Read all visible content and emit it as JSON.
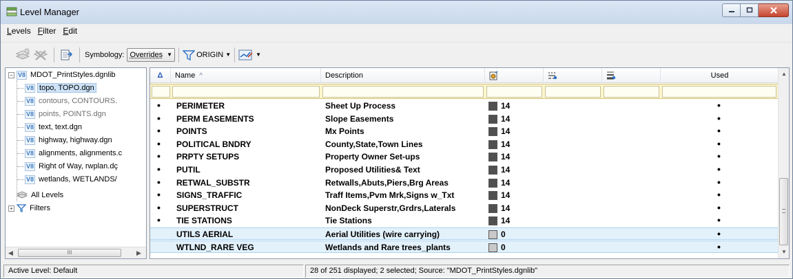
{
  "window": {
    "title": "Level Manager",
    "accent_color": "#cfdbea"
  },
  "menu": {
    "items": [
      {
        "underline": "L",
        "rest": "evels"
      },
      {
        "underline": "F",
        "rest": "ilter"
      },
      {
        "underline": "E",
        "rest": "dit"
      }
    ]
  },
  "toolbar": {
    "symbology_label": "Symbology:",
    "symbology_value": "Overrides",
    "origin_label": "ORIGIN"
  },
  "tree": {
    "root": "MDOT_PrintStyles.dgnlib",
    "children": [
      "topo, TOPO.dgn",
      "contours, CONTOURS.",
      "points, POINTS.dgn",
      "text, text.dgn",
      "highway, highway.dgn",
      "alignments, alignments.c",
      "Right of Way, rwplan.dç",
      "wetlands, WETLANDS/"
    ],
    "all_levels": "All Levels",
    "filters": "Filters",
    "scroll_grip": "III"
  },
  "table": {
    "headers": {
      "sort_indicator": "Δ",
      "name": "Name",
      "name_sort": "^",
      "description": "Description",
      "used": "Used"
    },
    "rows": [
      {
        "mark": "•",
        "name": "PERIMETER",
        "description": "Sheet Up Process",
        "color": "#505050",
        "weight": "14",
        "used": "•",
        "selected": false
      },
      {
        "mark": "•",
        "name": "PERM EASEMENTS",
        "description": "Slope Easements",
        "color": "#505050",
        "weight": "14",
        "used": "•",
        "selected": false
      },
      {
        "mark": "•",
        "name": "POINTS",
        "description": "Mx Points",
        "color": "#505050",
        "weight": "14",
        "used": "•",
        "selected": false
      },
      {
        "mark": "•",
        "name": "POLITICAL BNDRY",
        "description": "County,State,Town Lines",
        "color": "#505050",
        "weight": "14",
        "used": "•",
        "selected": false
      },
      {
        "mark": "•",
        "name": "PRPTY SETUPS",
        "description": "Property Owner Set-ups",
        "color": "#505050",
        "weight": "14",
        "used": "•",
        "selected": false
      },
      {
        "mark": "•",
        "name": "PUTIL",
        "description": "Proposed Utilities& Text",
        "color": "#505050",
        "weight": "14",
        "used": "•",
        "selected": false
      },
      {
        "mark": "•",
        "name": "RETWAL_SUBSTR",
        "description": "Retwalls,Abuts,Piers,Brg Areas",
        "color": "#505050",
        "weight": "14",
        "used": "•",
        "selected": false
      },
      {
        "mark": "•",
        "name": "SIGNS_TRAFFIC",
        "description": "Traff Items,Pvm Mrk,Signs w_Txt",
        "color": "#505050",
        "weight": "14",
        "used": "•",
        "selected": false
      },
      {
        "mark": "•",
        "name": "SUPERSTRUCT",
        "description": "NonDeck Superstr,Grdrs,Laterals",
        "color": "#505050",
        "weight": "14",
        "used": "•",
        "selected": false
      },
      {
        "mark": "•",
        "name": "TIE STATIONS",
        "description": "Tie Stations",
        "color": "#505050",
        "weight": "14",
        "used": "•",
        "selected": false
      },
      {
        "mark": "",
        "name": "UTILS AERIAL",
        "description": "Aerial Utilities (wire carrying)",
        "color": "#c8c8c8",
        "weight": "0",
        "used": "•",
        "selected": true
      },
      {
        "mark": "",
        "name": "WTLND_RARE VEG",
        "description": "Wetlands and Rare trees_plants",
        "color": "#c8c8c8",
        "weight": "0",
        "used": "•",
        "selected": true
      }
    ]
  },
  "status": {
    "active_level": "Active Level: Default",
    "summary": "28 of 251 displayed; 2 selected; Source: \"MDOT_PrintStyles.dgnlib\""
  }
}
